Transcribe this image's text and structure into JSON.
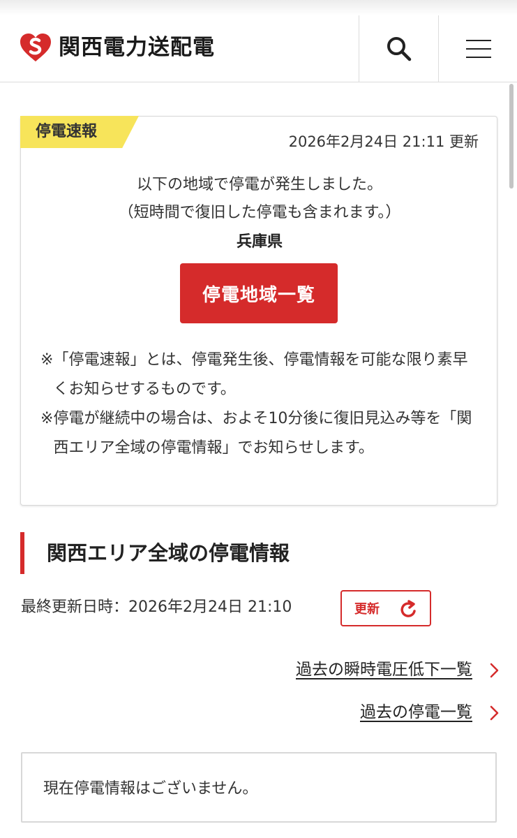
{
  "header": {
    "logo_text": "関西電力送配電",
    "brand_color": "#d52b2b",
    "search_icon": "search-icon",
    "menu_icon": "hamburger-menu-icon"
  },
  "flash": {
    "tag": "停電速報",
    "timestamp": "2026年2月24日 21:11 更新",
    "line1": "以下の地域で停電が発生しました。",
    "line2": "（短時間で復旧した停電も含まれます。）",
    "prefecture": "兵庫県",
    "button_label": "停電地域一覧",
    "notes": [
      {
        "mark": "※",
        "text": "「停電速報」とは、停電発生後、停電情報を可能な限り素早くお知らせするものです。"
      },
      {
        "mark": "※",
        "text": "停電が継続中の場合は、およそ10分後に復旧見込み等を「関西エリア全域の停電情報」でお知らせします。"
      }
    ],
    "tag_color": "#f7e45a"
  },
  "section": {
    "title": "関西エリア全域の停電情報",
    "last_updated": "最終更新日時：2026年2月24日 21:10",
    "refresh_label": "更新",
    "links": [
      "過去の瞬時電圧低下一覧",
      "過去の停電一覧"
    ],
    "status_message": "現在停電情報はございません。"
  }
}
